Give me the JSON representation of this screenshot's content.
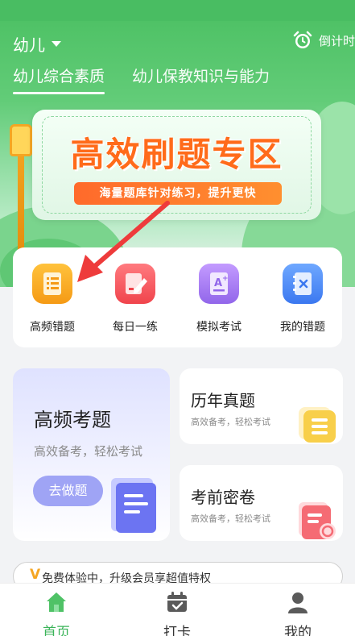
{
  "header": {
    "category": "幼儿",
    "countdown_label": "倒计时",
    "tabs": [
      {
        "label": "幼儿综合素质",
        "active": true
      },
      {
        "label": "幼儿保教知识与能力",
        "active": false
      }
    ]
  },
  "banner": {
    "title": "高效刷题专区",
    "subtitle": "海量题库针对练习，提升更快"
  },
  "quick_actions": [
    {
      "label": "高频错题",
      "icon": "list-doc-icon",
      "color": "#f5a01f"
    },
    {
      "label": "每日一练",
      "icon": "pencil-doc-icon",
      "color": "#f3545b"
    },
    {
      "label": "模拟考试",
      "icon": "exam-a-plus-icon",
      "color": "#a777ef"
    },
    {
      "label": "我的错题",
      "icon": "wrong-notebook-icon",
      "color": "#4f8ef7"
    }
  ],
  "features": {
    "high_freq": {
      "title": "高频考题",
      "subtitle": "高效备考，轻松考试",
      "button": "去做题"
    },
    "past_papers": {
      "title": "历年真题",
      "subtitle": "高效备考，轻松考试"
    },
    "mock_secret": {
      "title": "考前密卷",
      "subtitle": "高效备考，轻松考试"
    }
  },
  "promo": {
    "v": "V",
    "text": "免费体验中，升级会员享超值特权"
  },
  "bottom_nav": [
    {
      "label": "首页",
      "icon": "home-icon",
      "active": true
    },
    {
      "label": "打卡",
      "icon": "calendar-check-icon",
      "active": false
    },
    {
      "label": "我的",
      "icon": "user-icon",
      "active": false
    }
  ],
  "colors": {
    "primary": "#4fc266",
    "accent": "#ff6b1a",
    "nav_active": "#3bb45a"
  }
}
